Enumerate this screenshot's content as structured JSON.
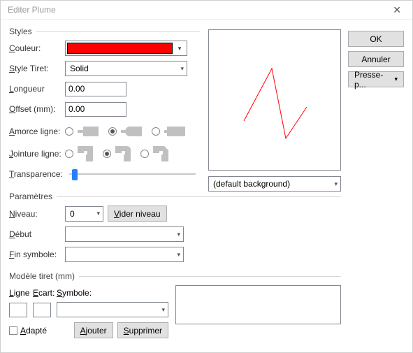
{
  "title": "Editer Plume",
  "buttons": {
    "ok": "OK",
    "cancel": "Annuler",
    "clipboard": "Presse-p...",
    "reset_level": "Vider niveau",
    "add": "Ajouter",
    "delete": "Supprimer"
  },
  "groups": {
    "styles": "Styles",
    "params": "Paramètres",
    "dash_model": "Modèle tiret (mm)"
  },
  "labels": {
    "color": "Couleur:",
    "style_dash": "Style Tiret:",
    "length": "Longueur",
    "offset": "Offset (mm):",
    "line_cap": "Amorce ligne:",
    "line_join": "Jointure ligne:",
    "transparency": "Transparence:",
    "level": "Niveau:",
    "start": "Début",
    "end_symbol": "Fin symbole:",
    "line": "Ligne",
    "gap": "Ecart:",
    "symbol": "Symbole:",
    "adapted": "Adapté"
  },
  "values": {
    "color": "#ff0000",
    "style_dash": "Solid",
    "length": "0.00",
    "offset": "0.00",
    "line_cap_selected": 1,
    "line_join_selected": 1,
    "transparency_pct": 2,
    "level": "0",
    "start": "",
    "end_symbol": "",
    "background": "(default background)",
    "line_dash": "",
    "gap_dash": "",
    "symbol_dash": "",
    "adapted": false
  },
  "close_glyph": "✕",
  "chevron": "▾",
  "underlined": {
    "color": "C",
    "style_dash": "S",
    "length": "L",
    "offset": "O",
    "cap": "A",
    "join": "J",
    "transp": "T",
    "level": "N",
    "reset": "V",
    "start": "D",
    "end": "F",
    "ln": "L",
    "gap": "E",
    "adapt": "A",
    "add": "A",
    "del": "S",
    "sym": "S"
  }
}
